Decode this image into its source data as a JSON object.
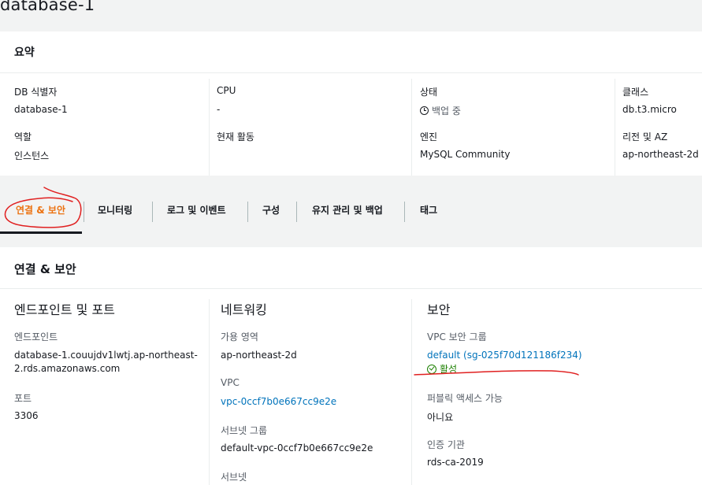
{
  "page_title": "database-1",
  "summary": {
    "title": "요약",
    "db_id": {
      "label": "DB 식별자",
      "value": "database-1"
    },
    "role": {
      "label": "역할",
      "value": "인스턴스"
    },
    "cpu": {
      "label": "CPU",
      "value": "-"
    },
    "activity": {
      "label": "현재 활동"
    },
    "status": {
      "label": "상태",
      "value": "백업 중"
    },
    "engine": {
      "label": "엔진",
      "value": "MySQL Community"
    },
    "class": {
      "label": "클래스",
      "value": "db.t3.micro"
    },
    "region": {
      "label": "리전 및 AZ",
      "value": "ap-northeast-2d"
    }
  },
  "tabs": [
    {
      "label": "연결 & 보안",
      "active": true
    },
    {
      "label": "모니터링"
    },
    {
      "label": "로그 및 이벤트"
    },
    {
      "label": "구성"
    },
    {
      "label": "유지 관리 및 백업"
    },
    {
      "label": "태그"
    }
  ],
  "connectivity": {
    "title": "연결 & 보안",
    "endpoint_section": {
      "title": "엔드포인트 및 포트",
      "endpoint_label": "엔드포인트",
      "endpoint_line1": "database-1.couujdv1lwtj.ap-northeast-",
      "endpoint_line2": "2.rds.amazonaws.com",
      "port_label": "포트",
      "port_value": "3306"
    },
    "network_section": {
      "title": "네트워킹",
      "az_label": "가용 영역",
      "az_value": "ap-northeast-2d",
      "vpc_label": "VPC",
      "vpc_value": "vpc-0ccf7b0e667cc9e2e",
      "subnet_group_label": "서브넷 그룹",
      "subnet_group_value": "default-vpc-0ccf7b0e667cc9e2e",
      "subnet_label": "서브넷"
    },
    "security_section": {
      "title": "보안",
      "sg_label": "VPC 보안 그룹",
      "sg_value": "default (sg-025f70d121186f234)",
      "sg_status": "활성",
      "public_label": "퍼블릭 액세스 가능",
      "public_value": "아니요",
      "ca_label": "인증 기관",
      "ca_value": "rds-ca-2019"
    }
  },
  "colors": {
    "accent": "#ec7211",
    "link": "#0073bb",
    "success": "#1d8102",
    "annotation": "#e02020"
  }
}
